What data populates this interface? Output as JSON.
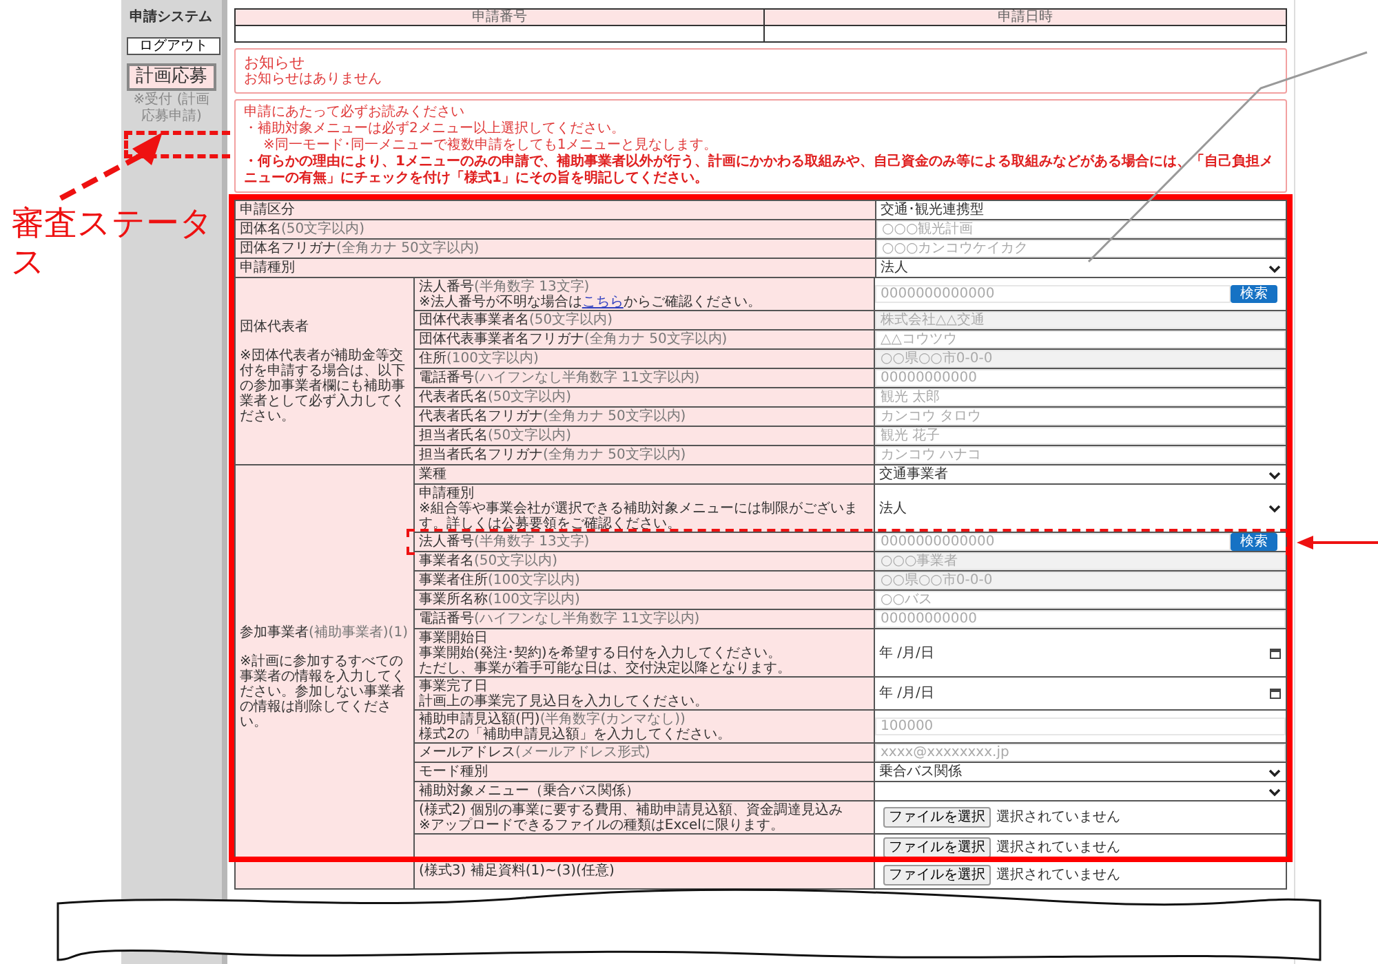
{
  "sidebar": {
    "title": "申請システム",
    "logout_button": "ログアウト",
    "menu_item": {
      "label": "計画応募",
      "selected": true
    },
    "status": "※受付 (計画応募申請)"
  },
  "application_header": {
    "columns": [
      "申請番号",
      "申請日時"
    ]
  },
  "notice": {
    "title": "お知らせ",
    "message": "お知らせはありません"
  },
  "instructions": {
    "heading": "申請にあたって必ずお読みください",
    "items": [
      {
        "kind": "bullet",
        "text": "・補助対象メニューは必ず2メニュー以上選択してください。"
      },
      {
        "kind": "note",
        "text": "※同一モード･同一メニューで複数申請をしても1メニューと見なします。"
      },
      {
        "kind": "important",
        "text": "・何らかの理由により、1メニューのみの申請で、補助事業者以外が行う、計画にかかわる取組みや、自己資金のみ等による取組みなどがある場合には、「自己負担メニューの有無」にチェックを付け「様式1」にその旨を明記してください。"
      }
    ]
  },
  "form": {
    "rows": [
      {
        "kind": "field",
        "label": "申請区分",
        "value": {
          "kind": "static",
          "text": "交通･観光連携型"
        }
      },
      {
        "kind": "field",
        "label": "団体名",
        "limit": "(50文字以内)",
        "value": {
          "kind": "input",
          "placeholder": "○○○観光計画"
        }
      },
      {
        "kind": "field",
        "label": "団体名フリガナ",
        "limit": "(全角カナ 50文字以内)",
        "value": {
          "kind": "input",
          "placeholder": "○○○カンコウケイカク"
        }
      },
      {
        "kind": "field",
        "label": "申請種別",
        "value": {
          "kind": "select",
          "value": "法人"
        }
      },
      {
        "kind": "group",
        "label": "団体代表者",
        "note": "※団体代表者が補助金等交付を申請する場合は、以下の参加事業者欄にも補助事業者として必ず入力してください。",
        "fields": [
          {
            "label": "法人番号",
            "limit": "(半角数字 13文字)",
            "hint_link": {
              "before": "※法人番号が不明な場合は",
              "link": "こちら",
              "after": "からご確認ください。"
            },
            "highlighted": false,
            "value": {
              "kind": "search",
              "placeholder": "0000000000000",
              "button": "検索"
            }
          },
          {
            "label": "団体代表事業者名",
            "limit": "(50文字以内)",
            "highlighted": false,
            "value": {
              "kind": "readonly",
              "placeholder": "株式会社△△交通"
            }
          },
          {
            "label": "団体代表事業者名フリガナ",
            "limit": "(全角カナ 50文字以内)",
            "highlighted": false,
            "value": {
              "kind": "input",
              "placeholder": "△△コウツウ"
            }
          },
          {
            "label": "住所",
            "limit": "(100文字以内)",
            "highlighted": false,
            "value": {
              "kind": "readonly",
              "placeholder": "○○県○○市0-0-0"
            }
          },
          {
            "label": "電話番号",
            "limit": "(ハイフンなし半角数字 11文字以内)",
            "highlighted": false,
            "value": {
              "kind": "input",
              "placeholder": "00000000000"
            }
          },
          {
            "label": "代表者氏名",
            "limit": "(50文字以内)",
            "highlighted": false,
            "value": {
              "kind": "input",
              "placeholder": "観光 太郎"
            }
          },
          {
            "label": "代表者氏名フリガナ",
            "limit": "(全角カナ 50文字以内)",
            "highlighted": false,
            "value": {
              "kind": "input",
              "placeholder": "カンコウ タロウ"
            }
          },
          {
            "label": "担当者氏名",
            "limit": "(50文字以内)",
            "highlighted": false,
            "value": {
              "kind": "input",
              "placeholder": "観光 花子"
            }
          },
          {
            "label": "担当者氏名フリガナ",
            "limit": "(全角カナ 50文字以内)",
            "highlighted": false,
            "value": {
              "kind": "input",
              "placeholder": "カンコウ ハナコ"
            }
          }
        ]
      },
      {
        "kind": "group",
        "label": "参加事業者",
        "limit": "(補助事業者)(1)",
        "note": "※計画に参加するすべての事業者の情報を入力してください。参加しない事業者の情報は削除してください。",
        "fields": [
          {
            "label": "業種",
            "highlighted": false,
            "value": {
              "kind": "select",
              "value": "交通事業者"
            }
          },
          {
            "label": "申請種別",
            "hints": [
              "※組合等や事業会社が選択できる補助対象メニューには制限がございます。詳しくは公募要領をご確認ください。"
            ],
            "highlighted": false,
            "value": {
              "kind": "select",
              "value": "法人"
            }
          },
          {
            "label": "法人番号",
            "limit": "(半角数字 13文字)",
            "highlighted": true,
            "value": {
              "kind": "search",
              "placeholder": "0000000000000",
              "button": "検索"
            }
          },
          {
            "label": "事業者名",
            "limit": "(50文字以内)",
            "highlighted": false,
            "value": {
              "kind": "readonly",
              "placeholder": "○○○事業者"
            }
          },
          {
            "label": "事業者住所",
            "limit": "(100文字以内)",
            "highlighted": false,
            "value": {
              "kind": "readonly",
              "placeholder": "○○県○○市0-0-0"
            }
          },
          {
            "label": "事業所名称",
            "limit": "(100文字以内)",
            "highlighted": false,
            "value": {
              "kind": "input",
              "placeholder": "○○バス"
            }
          },
          {
            "label": "電話番号",
            "limit": "(ハイフンなし半角数字 11文字以内)",
            "highlighted": false,
            "value": {
              "kind": "input",
              "placeholder": "00000000000"
            }
          },
          {
            "label": "事業開始日",
            "hints": [
              "事業開始(発注･契約)を希望する日付を入力してください。",
              "ただし、事業が着手可能な日は、交付決定以降となります。"
            ],
            "highlighted": false,
            "value": {
              "kind": "date",
              "placeholder": "年 /月/日"
            }
          },
          {
            "label": "事業完了日",
            "hints": [
              "計画上の事業完了見込日を入力してください。"
            ],
            "highlighted": false,
            "value": {
              "kind": "date",
              "placeholder": "年 /月/日"
            }
          },
          {
            "label": "補助申請見込額(円)",
            "limit": "(半角数字(カンマなし))",
            "hints": [
              "様式2の「補助申請見込額」を入力してください。"
            ],
            "highlighted": false,
            "value": {
              "kind": "input",
              "placeholder": "100000"
            }
          },
          {
            "label": "メールアドレス",
            "limit": "(メールアドレス形式)",
            "highlighted": false,
            "value": {
              "kind": "input",
              "placeholder": "xxxx@xxxxxxxx.jp"
            }
          },
          {
            "label": "モード種別",
            "highlighted": false,
            "value": {
              "kind": "select",
              "value": "乗合バス関係"
            }
          },
          {
            "label": "補助対象メニュー（乗合バス関係）",
            "highlighted": false,
            "value": {
              "kind": "select"
            }
          },
          {
            "label": "(様式2) 個別の事業に要する費用、補助申請見込額、資金調達見込み",
            "hints": [
              "※アップロードできるファイルの種類はExcelに限ります。"
            ],
            "highlighted": false,
            "value": {
              "kind": "file",
              "button": "ファイルを選択",
              "status": "選択されていません"
            }
          },
          {
            "highlighted": false,
            "value": {
              "kind": "file",
              "button": "ファイルを選択",
              "status": "選択されていません"
            }
          },
          {
            "label": "(様式3) 補足資料(1)~(3)(任意)",
            "highlighted": false,
            "value": {
              "kind": "file",
              "button": "ファイルを選択",
              "status": "選択されていません"
            }
          }
        ]
      }
    ]
  },
  "annotations": {
    "status_callout": "審査ステータス"
  }
}
